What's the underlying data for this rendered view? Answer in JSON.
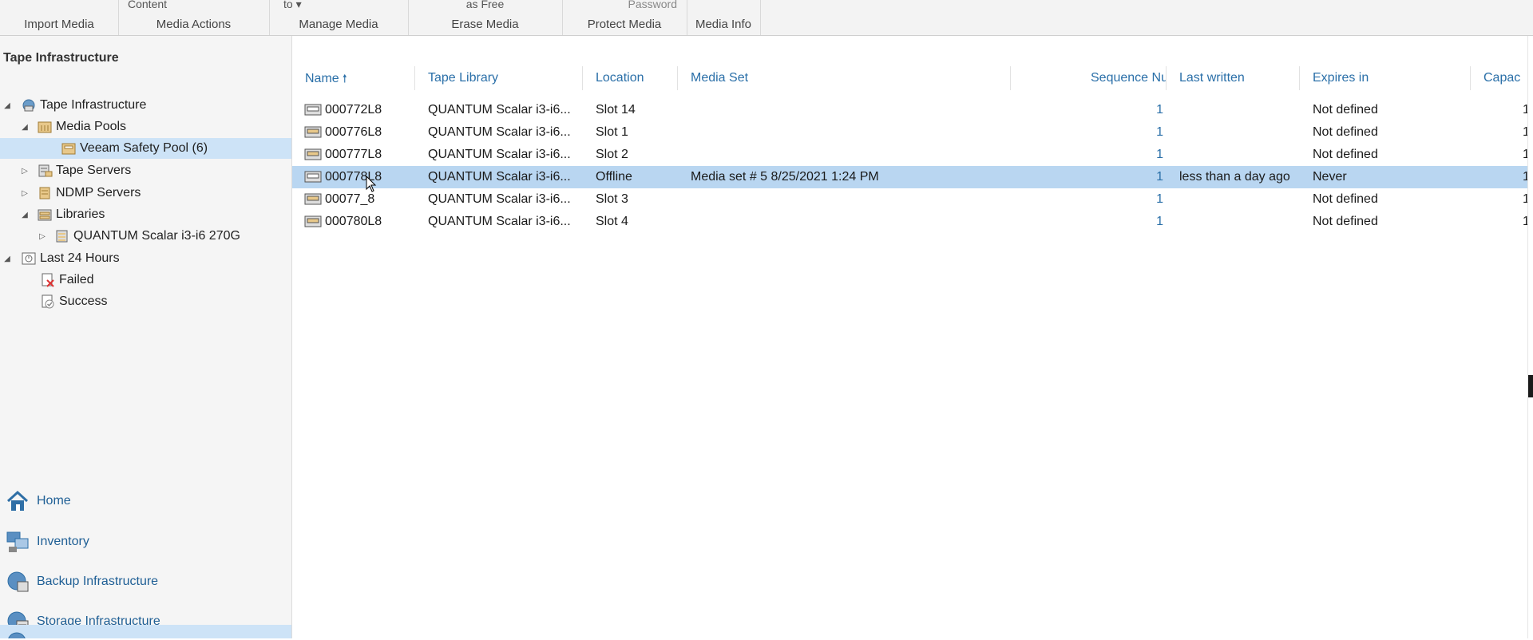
{
  "ribbon": {
    "groups": [
      {
        "top": "",
        "label": "Import Media"
      },
      {
        "top": "Content",
        "label": "Media Actions"
      },
      {
        "top": "to ▾",
        "label": "Manage Media"
      },
      {
        "top": "as Free",
        "label": "Erase Media"
      },
      {
        "top": "Password",
        "label": "Protect Media"
      },
      {
        "top": "",
        "label": "Media Info"
      }
    ]
  },
  "left": {
    "title": "Tape Infrastructure",
    "tree": [
      {
        "label": "Tape Infrastructure",
        "icon": "tape-infrastructure-icon"
      },
      {
        "label": "Media Pools",
        "icon": "media-pools-icon"
      },
      {
        "label": "Veeam Safety Pool (6)",
        "icon": "media-pool-icon"
      },
      {
        "label": "Tape Servers",
        "icon": "tape-servers-icon"
      },
      {
        "label": "NDMP Servers",
        "icon": "ndmp-servers-icon"
      },
      {
        "label": "Libraries",
        "icon": "libraries-icon"
      },
      {
        "label": "QUANTUM Scalar i3-i6 270G",
        "icon": "tape-library-icon"
      },
      {
        "label": "Last 24 Hours",
        "icon": "last-24-hours-icon"
      },
      {
        "label": "Failed",
        "icon": "failed-job-icon"
      },
      {
        "label": "Success",
        "icon": "success-job-icon"
      }
    ],
    "nav": [
      {
        "label": "Home",
        "icon": "home-icon"
      },
      {
        "label": "Inventory",
        "icon": "inventory-icon"
      },
      {
        "label": "Backup Infrastructure",
        "icon": "backup-infrastructure-icon"
      },
      {
        "label": "Storage Infrastructure",
        "icon": "storage-infrastructure-icon"
      },
      {
        "label": "",
        "icon": "tape-infrastructure-nav-icon"
      }
    ]
  },
  "grid": {
    "columns": [
      "Name",
      "Tape Library",
      "Location",
      "Media Set",
      "Sequence Number",
      "Last written",
      "Expires in",
      "Capac"
    ],
    "rows": [
      {
        "name": "000772L8",
        "library": "QUANTUM Scalar i3-i6...",
        "location": "Slot 14",
        "media_set": "",
        "sequence": "1",
        "last_written": "",
        "expires": "Not defined",
        "capacity": "1"
      },
      {
        "name": "000776L8",
        "library": "QUANTUM Scalar i3-i6...",
        "location": "Slot 1",
        "media_set": "",
        "sequence": "1",
        "last_written": "",
        "expires": "Not defined",
        "capacity": "1"
      },
      {
        "name": "000777L8",
        "library": "QUANTUM Scalar i3-i6...",
        "location": "Slot 2",
        "media_set": "",
        "sequence": "1",
        "last_written": "",
        "expires": "Not defined",
        "capacity": "1"
      },
      {
        "name": "000778L8",
        "library": "QUANTUM Scalar i3-i6...",
        "location": "Offline",
        "media_set": "Media set # 5 8/25/2021 1:24 PM",
        "sequence": "1",
        "last_written": "less than a day ago",
        "expires": "Never",
        "capacity": "1"
      },
      {
        "name": "00077_8",
        "library": "QUANTUM Scalar i3-i6...",
        "location": "Slot 3",
        "media_set": "",
        "sequence": "1",
        "last_written": "",
        "expires": "Not defined",
        "capacity": "1"
      },
      {
        "name": "000780L8",
        "library": "QUANTUM Scalar i3-i6...",
        "location": "Slot 4",
        "media_set": "",
        "sequence": "1",
        "last_written": "",
        "expires": "Not defined",
        "capacity": "1"
      }
    ]
  },
  "colors": {
    "selection": "#b9d6f1",
    "tree_selection": "#cde3f7",
    "header_text": "#2a6fa8",
    "nav_text": "#1f5f95"
  }
}
